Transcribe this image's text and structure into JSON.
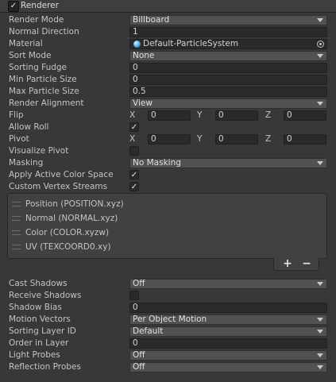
{
  "header": {
    "title": "Renderer",
    "checked": "✓"
  },
  "render_mode": {
    "label": "Render Mode",
    "value": "Billboard"
  },
  "normal_direction": {
    "label": "Normal Direction",
    "value": "1"
  },
  "material": {
    "label": "Material",
    "value": "Default-ParticleSystem"
  },
  "sort_mode": {
    "label": "Sort Mode",
    "value": "None"
  },
  "sorting_fudge": {
    "label": "Sorting Fudge",
    "value": "0"
  },
  "min_particle_size": {
    "label": "Min Particle Size",
    "value": "0"
  },
  "max_particle_size": {
    "label": "Max Particle Size",
    "value": "0.5"
  },
  "render_alignment": {
    "label": "Render Alignment",
    "value": "View"
  },
  "flip": {
    "label": "Flip",
    "x_label": "X",
    "x": "0",
    "y_label": "Y",
    "y": "0",
    "z_label": "Z",
    "z": "0"
  },
  "allow_roll": {
    "label": "Allow Roll",
    "checked": "✓"
  },
  "pivot": {
    "label": "Pivot",
    "x_label": "X",
    "x": "0",
    "y_label": "Y",
    "y": "0",
    "z_label": "Z",
    "z": "0"
  },
  "visualize_pivot": {
    "label": "Visualize Pivot",
    "checked": ""
  },
  "masking": {
    "label": "Masking",
    "value": "No Masking"
  },
  "apply_active_color_space": {
    "label": "Apply Active Color Space",
    "checked": "✓"
  },
  "custom_vertex_streams": {
    "label": "Custom Vertex Streams",
    "checked": "✓",
    "streams": [
      "Position (POSITION.xyz)",
      "Normal (NORMAL.xyz)",
      "Color (COLOR.xyzw)",
      "UV (TEXCOORD0.xy)"
    ],
    "add_label": "+",
    "remove_label": "−"
  },
  "cast_shadows": {
    "label": "Cast Shadows",
    "value": "Off"
  },
  "receive_shadows": {
    "label": "Receive Shadows",
    "checked": ""
  },
  "shadow_bias": {
    "label": "Shadow Bias",
    "value": "0"
  },
  "motion_vectors": {
    "label": "Motion Vectors",
    "value": "Per Object Motion"
  },
  "sorting_layer_id": {
    "label": "Sorting Layer ID",
    "value": "Default"
  },
  "order_in_layer": {
    "label": "Order in Layer",
    "value": "0"
  },
  "light_probes": {
    "label": "Light Probes",
    "value": "Off"
  },
  "reflection_probes": {
    "label": "Reflection Probes",
    "value": "Off"
  }
}
